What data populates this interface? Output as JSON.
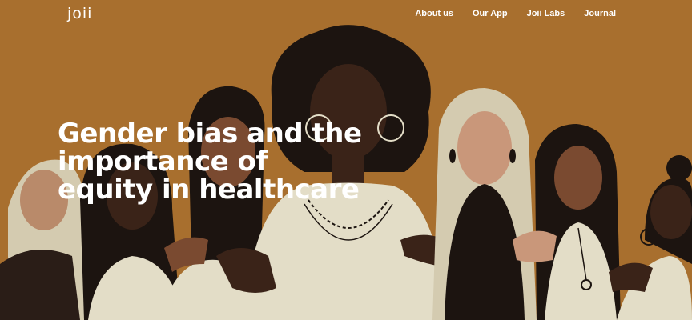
{
  "site": {
    "logo": "joii"
  },
  "nav": {
    "items": [
      {
        "label": "About us"
      },
      {
        "label": "Our App"
      },
      {
        "label": "Joii Labs"
      },
      {
        "label": "Journal"
      }
    ]
  },
  "hero": {
    "title_lines": [
      "Gender bias and the",
      "importance of",
      "equity in healthcare"
    ],
    "illustration": "group-of-diverse-women-illustration"
  },
  "colors": {
    "background": "#a86f2e",
    "text": "#ffffff",
    "cream": "#e3ddc7",
    "black": "#1c1410",
    "dark_skin": "#3a2318",
    "mid_skin": "#7a4a30",
    "light_skin": "#b98a6a",
    "peach_skin": "#c9977a"
  }
}
